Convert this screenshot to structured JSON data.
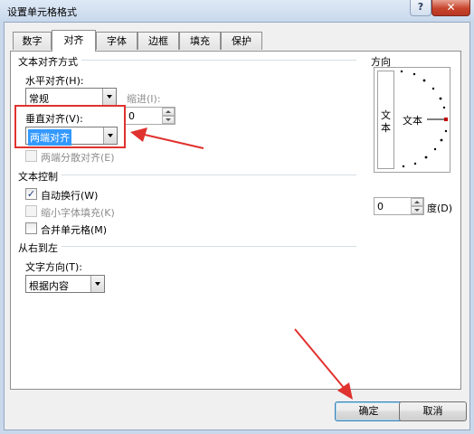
{
  "window": {
    "title": "设置单元格格式",
    "help_glyph": "?",
    "close_glyph": "✕"
  },
  "tabs": [
    {
      "label": "数字"
    },
    {
      "label": "对齐"
    },
    {
      "label": "字体"
    },
    {
      "label": "边框"
    },
    {
      "label": "填充"
    },
    {
      "label": "保护"
    }
  ],
  "active_tab": "对齐",
  "text_alignment": {
    "group_title": "文本对齐方式",
    "horizontal_label": "水平对齐(H):",
    "horizontal_value": "常规",
    "indent_label": "缩进(I):",
    "indent_value": "0",
    "vertical_label": "垂直对齐(V):",
    "vertical_value": "两端对齐",
    "distributed_label": "两端分散对齐(E)"
  },
  "text_control": {
    "group_title": "文本控制",
    "wrap_label": "自动换行(W)",
    "wrap_checked": true,
    "shrink_label": "缩小字体填充(K)",
    "shrink_checked": false,
    "merge_label": "合并单元格(M)",
    "merge_checked": false
  },
  "rtl": {
    "group_title": "从右到左",
    "direction_label": "文字方向(T):",
    "direction_value": "根据内容"
  },
  "orientation": {
    "group_title": "方向",
    "vertical_text": "文本",
    "dial_text": "文本",
    "degree_value": "0",
    "degree_label": "度(D)"
  },
  "buttons": {
    "ok": "确定",
    "cancel": "取消"
  },
  "colors": {
    "annotation_red": "#e0322e",
    "selection_blue": "#3399ff",
    "dial_red": "#c00000"
  }
}
